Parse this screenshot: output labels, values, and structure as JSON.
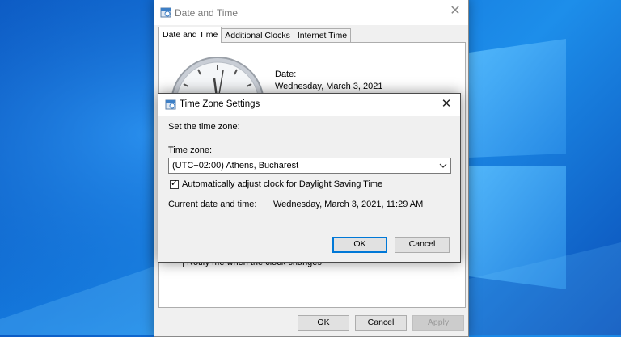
{
  "parent_dialog": {
    "title": "Date and Time",
    "icon": "datetime-icon",
    "close_glyph": "✕",
    "tabs": [
      {
        "label": "Date and Time",
        "active": true
      },
      {
        "label": "Additional Clocks",
        "active": false
      },
      {
        "label": "Internet Time",
        "active": false
      }
    ],
    "date_label": "Date:",
    "date_value": "Wednesday, March 3, 2021",
    "notify_label": "Notify me when the clock changes",
    "notify_checked": true,
    "buttons": {
      "ok": "OK",
      "cancel": "Cancel",
      "apply": "Apply"
    }
  },
  "timezone_dialog": {
    "title": "Time Zone Settings",
    "icon": "datetime-icon",
    "close_glyph": "✕",
    "heading": "Set the time zone:",
    "timezone_label": "Time zone:",
    "timezone_value": "(UTC+02:00) Athens, Bucharest",
    "dst_label": "Automatically adjust clock for Daylight Saving Time",
    "dst_checked": true,
    "current_label": "Current date and time:",
    "current_value": "Wednesday, March 3, 2021, 11:29 AM",
    "buttons": {
      "ok": "OK",
      "cancel": "Cancel"
    }
  },
  "colors": {
    "accent": "#0078d7",
    "desktop": "#1478dc"
  }
}
